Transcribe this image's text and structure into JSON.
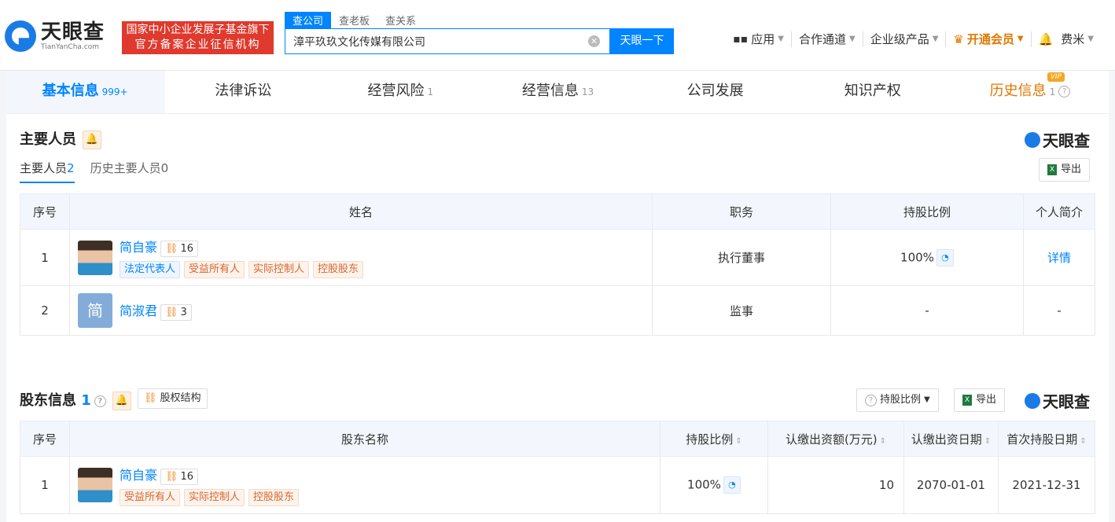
{
  "header": {
    "logo_cn": "天眼查",
    "logo_en": "TianYanCha.com",
    "badge_line1": "国家中小企业发展子基金旗下",
    "badge_line2": "官方备案企业征信机构",
    "search_tabs": [
      "查公司",
      "查老板",
      "查关系"
    ],
    "search_value": "漳平玖玖文化传媒有限公司",
    "search_button": "天眼一下",
    "nav": {
      "apps": "应用",
      "partner": "合作通道",
      "enterprise": "企业级产品",
      "vip": "开通会员",
      "user": "费米"
    }
  },
  "tabs": [
    {
      "label": "基本信息",
      "count": "999+"
    },
    {
      "label": "法律诉讼",
      "count": ""
    },
    {
      "label": "经营风险",
      "count": "1"
    },
    {
      "label": "经营信息",
      "count": "13"
    },
    {
      "label": "公司发展",
      "count": ""
    },
    {
      "label": "知识产权",
      "count": ""
    },
    {
      "label": "历史信息",
      "count": "1",
      "badge": "VIP"
    }
  ],
  "personnel": {
    "title": "主要人员",
    "watermark": "天眼查",
    "subtab_current": "主要人员",
    "subtab_current_count": "2",
    "subtab_history": "历史主要人员",
    "subtab_history_count": "0",
    "export": "导出",
    "columns": [
      "序号",
      "姓名",
      "职务",
      "持股比例",
      "个人简介"
    ],
    "rows": [
      {
        "idx": "1",
        "name": "简自豪",
        "rel_count": "16",
        "tags": [
          "法定代表人",
          "受益所有人",
          "实际控制人",
          "控股股东"
        ],
        "role": "执行董事",
        "ratio": "100%",
        "intro": "详情"
      },
      {
        "idx": "2",
        "name": "简淑君",
        "avatar_text": "简",
        "rel_count": "3",
        "tags": [],
        "role": "监事",
        "ratio": "-",
        "intro": "-"
      }
    ]
  },
  "shareholders": {
    "title": "股东信息",
    "count": "1",
    "structure": "股权结构",
    "ratio_btn": "持股比例",
    "export": "导出",
    "watermark": "天眼查",
    "columns": [
      "序号",
      "股东名称",
      "持股比例",
      "认缴出资额(万元)",
      "认缴出资日期",
      "首次持股日期"
    ],
    "rows": [
      {
        "idx": "1",
        "name": "简自豪",
        "rel_count": "16",
        "tags": [
          "受益所有人",
          "实际控制人",
          "控股股东"
        ],
        "ratio": "100%",
        "amount": "10",
        "sub_date": "2070-01-01",
        "first_date": "2021-12-31"
      }
    ]
  }
}
